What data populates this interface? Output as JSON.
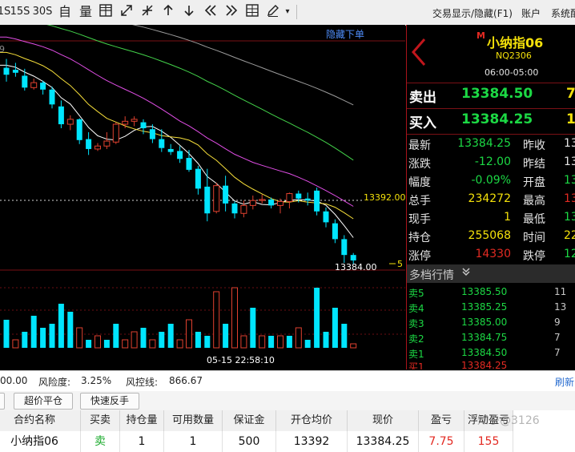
{
  "toolbar": {
    "icons": [
      "1S",
      "15S",
      "30S",
      "自",
      "量",
      "grid-icon",
      "expand-icon",
      "collapse-icon",
      "arrow-up-icon",
      "arrow-down-icon",
      "double-left-icon",
      "double-right-icon",
      "table-icon",
      "pen-icon",
      "dropdown-icon"
    ],
    "glyph_1s": "1S",
    "glyph_15s": "15S",
    "glyph_30s": "30S",
    "glyph_zi": "自",
    "glyph_liang": "量",
    "trade_toggle": "交易显示/隐藏(F1)",
    "account": "账户",
    "system": "系统配"
  },
  "chart": {
    "hide_order_label": "隐藏下单",
    "level_marker": "13392.00",
    "last_price_marker": "13384.00",
    "axis_tick_5": "5",
    "crosshair_time": "05-15 22:58:10",
    "top_left_fragment": "9",
    "colors": {
      "up": "#00e5ff",
      "down": "#e0412f",
      "ma5": "#ffffff",
      "ma10": "#f7df3a",
      "ma20": "#e14ee6",
      "ma40": "#43d24a",
      "ma60": "#9b9b9b"
    }
  },
  "chart_data": {
    "type": "candlestick",
    "candles": [
      {
        "o": 13403.7,
        "h": 13404.6,
        "l": 13402.3,
        "c": 13403.0
      },
      {
        "o": 13403.5,
        "h": 13404.2,
        "l": 13402.8,
        "c": 13403.2
      },
      {
        "o": 13402.9,
        "h": 13403.6,
        "l": 13401.4,
        "c": 13401.7
      },
      {
        "o": 13401.7,
        "h": 13402.6,
        "l": 13401.5,
        "c": 13402.2
      },
      {
        "o": 13402.2,
        "h": 13402.4,
        "l": 13401.0,
        "c": 13401.5
      },
      {
        "o": 13401.5,
        "h": 13401.8,
        "l": 13399.6,
        "c": 13400.0
      },
      {
        "o": 13399.8,
        "h": 13400.4,
        "l": 13397.6,
        "c": 13398.0
      },
      {
        "o": 13398.0,
        "h": 13398.9,
        "l": 13397.4,
        "c": 13398.5
      },
      {
        "o": 13398.5,
        "h": 13398.6,
        "l": 13396.0,
        "c": 13396.4
      },
      {
        "o": 13396.5,
        "h": 13397.2,
        "l": 13394.9,
        "c": 13395.5
      },
      {
        "o": 13395.5,
        "h": 13396.1,
        "l": 13395.3,
        "c": 13395.8
      },
      {
        "o": 13395.8,
        "h": 13397.2,
        "l": 13395.5,
        "c": 13396.3
      },
      {
        "o": 13396.2,
        "h": 13398.2,
        "l": 13396.0,
        "c": 13398.0
      },
      {
        "o": 13398.0,
        "h": 13398.8,
        "l": 13397.6,
        "c": 13398.3
      },
      {
        "o": 13398.3,
        "h": 13398.8,
        "l": 13397.8,
        "c": 13398.5
      },
      {
        "o": 13398.2,
        "h": 13398.5,
        "l": 13397.0,
        "c": 13397.6
      },
      {
        "o": 13397.5,
        "h": 13398.0,
        "l": 13396.1,
        "c": 13396.5
      },
      {
        "o": 13396.5,
        "h": 13397.5,
        "l": 13395.2,
        "c": 13395.6
      },
      {
        "o": 13395.5,
        "h": 13396.0,
        "l": 13394.9,
        "c": 13395.2
      },
      {
        "o": 13395.3,
        "h": 13395.8,
        "l": 13394.1,
        "c": 13394.5
      },
      {
        "o": 13394.6,
        "h": 13395.4,
        "l": 13393.2,
        "c": 13393.4
      },
      {
        "o": 13393.5,
        "h": 13393.8,
        "l": 13390.9,
        "c": 13391.5
      },
      {
        "o": 13391.7,
        "h": 13393.5,
        "l": 13388.2,
        "c": 13389.0
      },
      {
        "o": 13389.2,
        "h": 13392.1,
        "l": 13389.0,
        "c": 13391.8
      },
      {
        "o": 13391.8,
        "h": 13392.8,
        "l": 13389.2,
        "c": 13390.0
      },
      {
        "o": 13390.0,
        "h": 13390.2,
        "l": 13388.5,
        "c": 13389.0
      },
      {
        "o": 13389.0,
        "h": 13390.3,
        "l": 13388.6,
        "c": 13389.8
      },
      {
        "o": 13389.8,
        "h": 13390.8,
        "l": 13389.4,
        "c": 13390.3
      },
      {
        "o": 13390.3,
        "h": 13390.9,
        "l": 13390.0,
        "c": 13390.4
      },
      {
        "o": 13390.4,
        "h": 13390.6,
        "l": 13389.5,
        "c": 13389.8
      },
      {
        "o": 13389.8,
        "h": 13390.5,
        "l": 13389.0,
        "c": 13390.2
      },
      {
        "o": 13390.2,
        "h": 13391.1,
        "l": 13389.5,
        "c": 13391.0
      },
      {
        "o": 13391.0,
        "h": 13391.3,
        "l": 13390.1,
        "c": 13390.5
      },
      {
        "o": 13390.5,
        "h": 13391.1,
        "l": 13389.8,
        "c": 13390.3
      },
      {
        "o": 13391.3,
        "h": 13391.6,
        "l": 13388.8,
        "c": 13389.2
      },
      {
        "o": 13389.2,
        "h": 13389.6,
        "l": 13387.6,
        "c": 13388.1
      },
      {
        "o": 13388.0,
        "h": 13388.4,
        "l": 13386.0,
        "c": 13386.4
      },
      {
        "o": 13386.4,
        "h": 13386.8,
        "l": 13384.0,
        "c": 13384.8
      },
      {
        "o": 13384.8,
        "h": 13385.0,
        "l": 13383.9,
        "c": 13384.25
      }
    ],
    "volume": [
      7,
      2,
      4,
      8,
      5,
      6,
      11,
      9,
      5,
      2,
      3,
      2,
      6,
      2,
      4,
      5,
      2,
      4,
      6,
      2,
      7,
      4,
      3,
      14,
      6,
      15,
      3,
      10,
      3,
      3,
      3,
      3,
      5,
      2,
      15,
      4,
      10,
      6,
      1
    ],
    "volume_dir": [
      "u",
      "d",
      "u",
      "u",
      "u",
      "u",
      "u",
      "u",
      "d",
      "u",
      "d",
      "u",
      "u",
      "d",
      "d",
      "u",
      "d",
      "u",
      "u",
      "d",
      "d",
      "u",
      "u",
      "d",
      "u",
      "d",
      "d",
      "u",
      "d",
      "u",
      "d",
      "u",
      "d",
      "u",
      "u",
      "u",
      "u",
      "u",
      "d"
    ]
  },
  "quote": {
    "marker": "M",
    "name": "小纳指06",
    "code": "NQ2306",
    "hours": "06:00-05:00",
    "ask_label": "卖出",
    "ask_price": "13384.50",
    "ask_qty": "7",
    "bid_label": "买入",
    "bid_price": "13384.25",
    "bid_qty": "1",
    "rows": [
      {
        "l1": "最新",
        "v1": "13384.25",
        "c1": "#1cd844",
        "l2": "昨收",
        "v2": "13"
      },
      {
        "l1": "涨跌",
        "v1": "-12.00",
        "c1": "#1cd844",
        "l2": "昨结",
        "v2": "13"
      },
      {
        "l1": "幅度",
        "v1": "-0.09%",
        "c1": "#1cd844",
        "l2": "开盘",
        "v2": "13"
      },
      {
        "l1": "总手",
        "v1": "234272",
        "c1": "#f4e10a",
        "l2": "最高",
        "v2": "13"
      },
      {
        "l1": "现手",
        "v1": "1",
        "c1": "#f4e10a",
        "l2": "最低",
        "v2": "13"
      },
      {
        "l1": "持仓",
        "v1": "255068",
        "c1": "#f4e10a",
        "l2": "时间",
        "v2": "22"
      },
      {
        "l1": "涨停",
        "v1": "14330",
        "c1": "#e32a22",
        "l2": "跌停",
        "v2": "12"
      }
    ],
    "row_v2_colors": [
      "#e5e5e5",
      "#e5e5e5",
      "#1cd844",
      "#e32a22",
      "#1cd844",
      "#f4e10a",
      "#1cd844"
    ],
    "depth_title": "多档行情",
    "levels": [
      {
        "name": "卖5",
        "price": "13385.50",
        "qty": "11"
      },
      {
        "name": "卖4",
        "price": "13385.25",
        "qty": "13"
      },
      {
        "name": "卖3",
        "price": "13385.00",
        "qty": "9"
      },
      {
        "name": "卖2",
        "price": "13384.75",
        "qty": "7"
      },
      {
        "name": "卖1",
        "price": "13384.50",
        "qty": "7"
      }
    ],
    "partial_level": {
      "name": "买1",
      "price": "13384.25",
      "qty": ""
    }
  },
  "status": {
    "left_fragment": "00.00",
    "risk_label": "风险度:",
    "risk_value": "3.25%",
    "line_label": "风控线:",
    "line_value": "866.67",
    "refresh": "刷新"
  },
  "buttons": {
    "close_position": "超价平仓",
    "reverse": "快速反手"
  },
  "positions": {
    "headers": [
      "合约名称",
      "买卖",
      "持仓量",
      "可用数量",
      "保证金",
      "开仓均价",
      "现价",
      "盈亏",
      "浮动盈亏"
    ],
    "rows": [
      {
        "name": "小纳指06",
        "side": "卖",
        "qty": "1",
        "avail": "1",
        "margin": "500",
        "open_avg": "13392",
        "price": "13384.25",
        "pnl": "7.75",
        "float_pnl": "155"
      }
    ]
  },
  "watermark": "知乎@3126"
}
